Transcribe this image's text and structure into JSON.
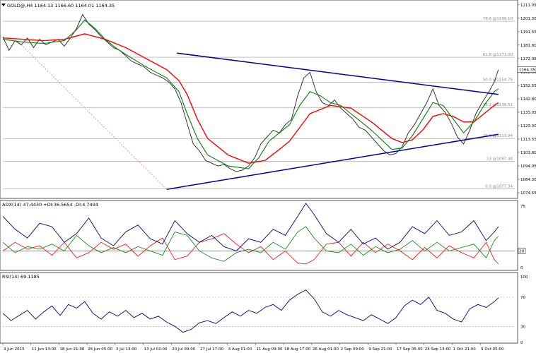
{
  "chart_data": {
    "type": "line",
    "symbol_info": "GOLD@,H4  1164.13 1166.60 1164.01 1164.35",
    "current_price_label": "1164.35",
    "price_axis": {
      "ylim": [
        1072.0,
        1213.0
      ],
      "ticks": [
        "1211.05",
        "1201.30",
        "1191.55",
        "1181.80",
        "1172.05",
        "1162.30",
        "1152.55",
        "1142.80",
        "1133.05",
        "1123.30",
        "1113.55",
        "1103.80",
        "1094.05",
        "1084.30",
        "1074.55"
      ]
    },
    "x_axis": {
      "labels": [
        "4 Jun 2015",
        "11 Jun 13:00",
        "18 Jun 21:00",
        "26 Jun 05:00",
        "3 Jul 13:00",
        "13 Jul 02:00",
        "20 Jul 09:00",
        "27 Jul 17:00",
        "4 Aug 01:00",
        "11 Aug 09:00",
        "18 Aug 17:00",
        "26 Aug 01:00",
        "2 Sep 09:00",
        "9 Sep 21:00",
        "17 Sep 05:00",
        "24 Sep 13:00",
        "1 Oct 21:00",
        "9 Oct 05:00"
      ]
    },
    "fibonacci": [
      {
        "label": "78.6 @1199.10",
        "price": 1199.1
      },
      {
        "label": "61.8 @1173.00",
        "price": 1173.0
      },
      {
        "label": "50.0 @1154.75",
        "price": 1154.75
      },
      {
        "label": "38.2 @1136.51",
        "price": 1136.51
      },
      {
        "label": "23.6 @1113.94",
        "price": 1113.94
      },
      {
        "label": "13 @1097.48",
        "price": 1097.48
      },
      {
        "label": "0.0 @1077.34",
        "price": 1077.34
      }
    ],
    "close_series": [
      [
        0,
        1188
      ],
      [
        3,
        1178
      ],
      [
        6,
        1185
      ],
      [
        9,
        1182
      ],
      [
        12,
        1187
      ],
      [
        15,
        1180
      ],
      [
        18,
        1186
      ],
      [
        21,
        1182
      ],
      [
        24,
        1184
      ],
      [
        27,
        1186
      ],
      [
        30,
        1181
      ],
      [
        33,
        1187
      ],
      [
        36,
        1194
      ],
      [
        39,
        1204
      ],
      [
        42,
        1197
      ],
      [
        45,
        1193
      ],
      [
        48,
        1188
      ],
      [
        51,
        1184
      ],
      [
        54,
        1180
      ],
      [
        57,
        1178
      ],
      [
        60,
        1174
      ],
      [
        63,
        1170
      ],
      [
        66,
        1168
      ],
      [
        69,
        1166
      ],
      [
        72,
        1162
      ],
      [
        75,
        1160
      ],
      [
        78,
        1158
      ],
      [
        81,
        1155
      ],
      [
        84,
        1150
      ],
      [
        87,
        1140
      ],
      [
        90,
        1125
      ],
      [
        93,
        1110
      ],
      [
        96,
        1105
      ],
      [
        99,
        1098
      ],
      [
        102,
        1096
      ],
      [
        105,
        1094
      ],
      [
        108,
        1095
      ],
      [
        111,
        1092
      ],
      [
        114,
        1090
      ],
      [
        117,
        1091
      ],
      [
        120,
        1094
      ],
      [
        123,
        1100
      ],
      [
        126,
        1110
      ],
      [
        129,
        1115
      ],
      [
        132,
        1120
      ],
      [
        135,
        1118
      ],
      [
        138,
        1124
      ],
      [
        141,
        1128
      ],
      [
        144,
        1145
      ],
      [
        147,
        1158
      ],
      [
        150,
        1162
      ],
      [
        153,
        1148
      ],
      [
        156,
        1140
      ],
      [
        159,
        1138
      ],
      [
        162,
        1142
      ],
      [
        165,
        1136
      ],
      [
        168,
        1132
      ],
      [
        171,
        1128
      ],
      [
        174,
        1122
      ],
      [
        177,
        1120
      ],
      [
        180,
        1115
      ],
      [
        183,
        1110
      ],
      [
        186,
        1105
      ],
      [
        189,
        1102
      ],
      [
        192,
        1103
      ],
      [
        195,
        1108
      ],
      [
        198,
        1118
      ],
      [
        201,
        1124
      ],
      [
        204,
        1132
      ],
      [
        207,
        1140
      ],
      [
        210,
        1150
      ],
      [
        213,
        1138
      ],
      [
        216,
        1133
      ],
      [
        219,
        1125
      ],
      [
        222,
        1115
      ],
      [
        225,
        1110
      ],
      [
        228,
        1120
      ],
      [
        231,
        1132
      ],
      [
        234,
        1140
      ],
      [
        237,
        1147
      ],
      [
        240,
        1155
      ],
      [
        242,
        1164
      ]
    ],
    "ema_green": [
      [
        0,
        1186
      ],
      [
        10,
        1184
      ],
      [
        20,
        1183
      ],
      [
        30,
        1185
      ],
      [
        36,
        1193
      ],
      [
        40,
        1200
      ],
      [
        45,
        1194
      ],
      [
        50,
        1186
      ],
      [
        55,
        1180
      ],
      [
        60,
        1175
      ],
      [
        70,
        1166
      ],
      [
        80,
        1158
      ],
      [
        86,
        1148
      ],
      [
        90,
        1132
      ],
      [
        95,
        1114
      ],
      [
        100,
        1102
      ],
      [
        110,
        1094
      ],
      [
        120,
        1092
      ],
      [
        125,
        1100
      ],
      [
        130,
        1112
      ],
      [
        135,
        1118
      ],
      [
        140,
        1124
      ],
      [
        145,
        1138
      ],
      [
        150,
        1148
      ],
      [
        155,
        1145
      ],
      [
        160,
        1140
      ],
      [
        165,
        1138
      ],
      [
        170,
        1132
      ],
      [
        180,
        1120
      ],
      [
        190,
        1106
      ],
      [
        195,
        1107
      ],
      [
        200,
        1116
      ],
      [
        205,
        1128
      ],
      [
        210,
        1140
      ],
      [
        215,
        1138
      ],
      [
        220,
        1128
      ],
      [
        225,
        1118
      ],
      [
        230,
        1126
      ],
      [
        235,
        1138
      ],
      [
        240,
        1148
      ],
      [
        242,
        1150
      ]
    ],
    "ema_red": [
      [
        0,
        1187
      ],
      [
        10,
        1186
      ],
      [
        20,
        1185
      ],
      [
        30,
        1186
      ],
      [
        40,
        1190
      ],
      [
        50,
        1186
      ],
      [
        60,
        1180
      ],
      [
        70,
        1172
      ],
      [
        80,
        1164
      ],
      [
        86,
        1156
      ],
      [
        90,
        1146
      ],
      [
        95,
        1128
      ],
      [
        100,
        1114
      ],
      [
        110,
        1102
      ],
      [
        120,
        1096
      ],
      [
        128,
        1098
      ],
      [
        135,
        1106
      ],
      [
        140,
        1112
      ],
      [
        145,
        1122
      ],
      [
        150,
        1132
      ],
      [
        160,
        1138
      ],
      [
        170,
        1136
      ],
      [
        180,
        1126
      ],
      [
        190,
        1114
      ],
      [
        195,
        1111
      ],
      [
        200,
        1113
      ],
      [
        205,
        1120
      ],
      [
        210,
        1130
      ],
      [
        215,
        1132
      ],
      [
        220,
        1130
      ],
      [
        225,
        1126
      ],
      [
        230,
        1126
      ],
      [
        235,
        1132
      ],
      [
        240,
        1138
      ],
      [
        242,
        1140
      ]
    ],
    "trend_upper": [
      [
        85,
        1176
      ],
      [
        242,
        1146
      ]
    ],
    "trend_lower": [
      [
        80,
        1077
      ],
      [
        242,
        1117
      ]
    ],
    "fib_line": [
      [
        7,
        1185
      ],
      [
        80,
        1077
      ]
    ],
    "adx_panel": {
      "label": "ADX(14) 47.4430 +DI:36.5654 -DI:4.7494",
      "ylim": [
        0,
        75
      ],
      "ticks": [
        "75",
        "20",
        "0"
      ],
      "ref_level": 20,
      "adx": [
        [
          0,
          60
        ],
        [
          6,
          45
        ],
        [
          12,
          35
        ],
        [
          18,
          52
        ],
        [
          24,
          48
        ],
        [
          30,
          30
        ],
        [
          36,
          40
        ],
        [
          42,
          58
        ],
        [
          48,
          35
        ],
        [
          54,
          26
        ],
        [
          60,
          42
        ],
        [
          66,
          50
        ],
        [
          72,
          34
        ],
        [
          78,
          28
        ],
        [
          84,
          55
        ],
        [
          90,
          40
        ],
        [
          96,
          30
        ],
        [
          102,
          38
        ],
        [
          108,
          25
        ],
        [
          114,
          20
        ],
        [
          120,
          34
        ],
        [
          126,
          30
        ],
        [
          132,
          45
        ],
        [
          138,
          38
        ],
        [
          144,
          60
        ],
        [
          148,
          75
        ],
        [
          152,
          62
        ],
        [
          158,
          40
        ],
        [
          164,
          30
        ],
        [
          170,
          45
        ],
        [
          176,
          28
        ],
        [
          182,
          35
        ],
        [
          188,
          22
        ],
        [
          194,
          30
        ],
        [
          200,
          48
        ],
        [
          206,
          40
        ],
        [
          212,
          55
        ],
        [
          218,
          38
        ],
        [
          224,
          42
        ],
        [
          230,
          55
        ],
        [
          236,
          32
        ],
        [
          240,
          42
        ],
        [
          242,
          48
        ]
      ],
      "plus_di": [
        [
          0,
          30
        ],
        [
          6,
          18
        ],
        [
          12,
          25
        ],
        [
          18,
          22
        ],
        [
          24,
          28
        ],
        [
          30,
          20
        ],
        [
          36,
          38
        ],
        [
          42,
          26
        ],
        [
          48,
          18
        ],
        [
          54,
          24
        ],
        [
          60,
          18
        ],
        [
          66,
          25
        ],
        [
          72,
          20
        ],
        [
          78,
          15
        ],
        [
          84,
          42
        ],
        [
          90,
          38
        ],
        [
          96,
          20
        ],
        [
          102,
          12
        ],
        [
          108,
          8
        ],
        [
          114,
          18
        ],
        [
          120,
          22
        ],
        [
          126,
          18
        ],
        [
          132,
          30
        ],
        [
          138,
          22
        ],
        [
          144,
          42
        ],
        [
          148,
          48
        ],
        [
          152,
          35
        ],
        [
          158,
          20
        ],
        [
          164,
          18
        ],
        [
          170,
          28
        ],
        [
          176,
          15
        ],
        [
          182,
          25
        ],
        [
          188,
          18
        ],
        [
          194,
          22
        ],
        [
          200,
          32
        ],
        [
          206,
          20
        ],
        [
          212,
          30
        ],
        [
          218,
          20
        ],
        [
          224,
          24
        ],
        [
          230,
          28
        ],
        [
          236,
          12
        ],
        [
          240,
          32
        ],
        [
          242,
          37
        ]
      ],
      "minus_di": [
        [
          0,
          20
        ],
        [
          6,
          30
        ],
        [
          12,
          22
        ],
        [
          18,
          26
        ],
        [
          24,
          15
        ],
        [
          30,
          30
        ],
        [
          36,
          12
        ],
        [
          42,
          18
        ],
        [
          48,
          30
        ],
        [
          54,
          22
        ],
        [
          60,
          28
        ],
        [
          66,
          14
        ],
        [
          72,
          26
        ],
        [
          78,
          35
        ],
        [
          84,
          10
        ],
        [
          90,
          14
        ],
        [
          96,
          30
        ],
        [
          102,
          34
        ],
        [
          108,
          40
        ],
        [
          114,
          28
        ],
        [
          120,
          18
        ],
        [
          126,
          25
        ],
        [
          132,
          10
        ],
        [
          138,
          20
        ],
        [
          144,
          6
        ],
        [
          148,
          5
        ],
        [
          152,
          10
        ],
        [
          158,
          28
        ],
        [
          164,
          30
        ],
        [
          170,
          14
        ],
        [
          176,
          30
        ],
        [
          182,
          18
        ],
        [
          188,
          28
        ],
        [
          194,
          20
        ],
        [
          200,
          10
        ],
        [
          206,
          24
        ],
        [
          212,
          12
        ],
        [
          218,
          26
        ],
        [
          224,
          18
        ],
        [
          230,
          12
        ],
        [
          236,
          30
        ],
        [
          240,
          10
        ],
        [
          242,
          5
        ]
      ]
    },
    "rsi_panel": {
      "label": "RSI(14) 69.1185",
      "ylim": [
        10,
        100
      ],
      "ticks": [
        "100",
        "70",
        "30",
        "0"
      ],
      "levels": [
        70,
        30
      ],
      "rsi": [
        [
          0,
          48
        ],
        [
          4,
          38
        ],
        [
          8,
          45
        ],
        [
          12,
          52
        ],
        [
          16,
          40
        ],
        [
          20,
          50
        ],
        [
          24,
          58
        ],
        [
          28,
          45
        ],
        [
          32,
          60
        ],
        [
          36,
          55
        ],
        [
          40,
          64
        ],
        [
          44,
          48
        ],
        [
          48,
          40
        ],
        [
          52,
          50
        ],
        [
          56,
          44
        ],
        [
          60,
          52
        ],
        [
          64,
          42
        ],
        [
          68,
          48
        ],
        [
          72,
          40
        ],
        [
          76,
          44
        ],
        [
          80,
          36
        ],
        [
          84,
          30
        ],
        [
          88,
          22
        ],
        [
          92,
          26
        ],
        [
          96,
          35
        ],
        [
          100,
          38
        ],
        [
          104,
          34
        ],
        [
          108,
          42
        ],
        [
          112,
          50
        ],
        [
          116,
          44
        ],
        [
          120,
          52
        ],
        [
          124,
          48
        ],
        [
          128,
          56
        ],
        [
          132,
          60
        ],
        [
          136,
          52
        ],
        [
          140,
          66
        ],
        [
          144,
          74
        ],
        [
          148,
          80
        ],
        [
          152,
          68
        ],
        [
          156,
          50
        ],
        [
          160,
          44
        ],
        [
          164,
          52
        ],
        [
          168,
          46
        ],
        [
          172,
          42
        ],
        [
          176,
          38
        ],
        [
          180,
          46
        ],
        [
          184,
          40
        ],
        [
          188,
          34
        ],
        [
          192,
          42
        ],
        [
          196,
          58
        ],
        [
          200,
          66
        ],
        [
          204,
          60
        ],
        [
          208,
          70
        ],
        [
          212,
          52
        ],
        [
          216,
          48
        ],
        [
          220,
          40
        ],
        [
          224,
          36
        ],
        [
          228,
          54
        ],
        [
          232,
          60
        ],
        [
          236,
          56
        ],
        [
          240,
          64
        ],
        [
          242,
          69
        ]
      ]
    },
    "colors": {
      "price": "#222222",
      "ema_green": "#008000",
      "ema_red": "#ff0000",
      "trendline": "#000099",
      "fib_line": "#ff6666",
      "fib_level": "#999999",
      "adx": "#000080",
      "plus_di": "#008000",
      "minus_di": "#ff0000",
      "rsi": "#000080",
      "badge_bg": "#ffffff"
    }
  }
}
